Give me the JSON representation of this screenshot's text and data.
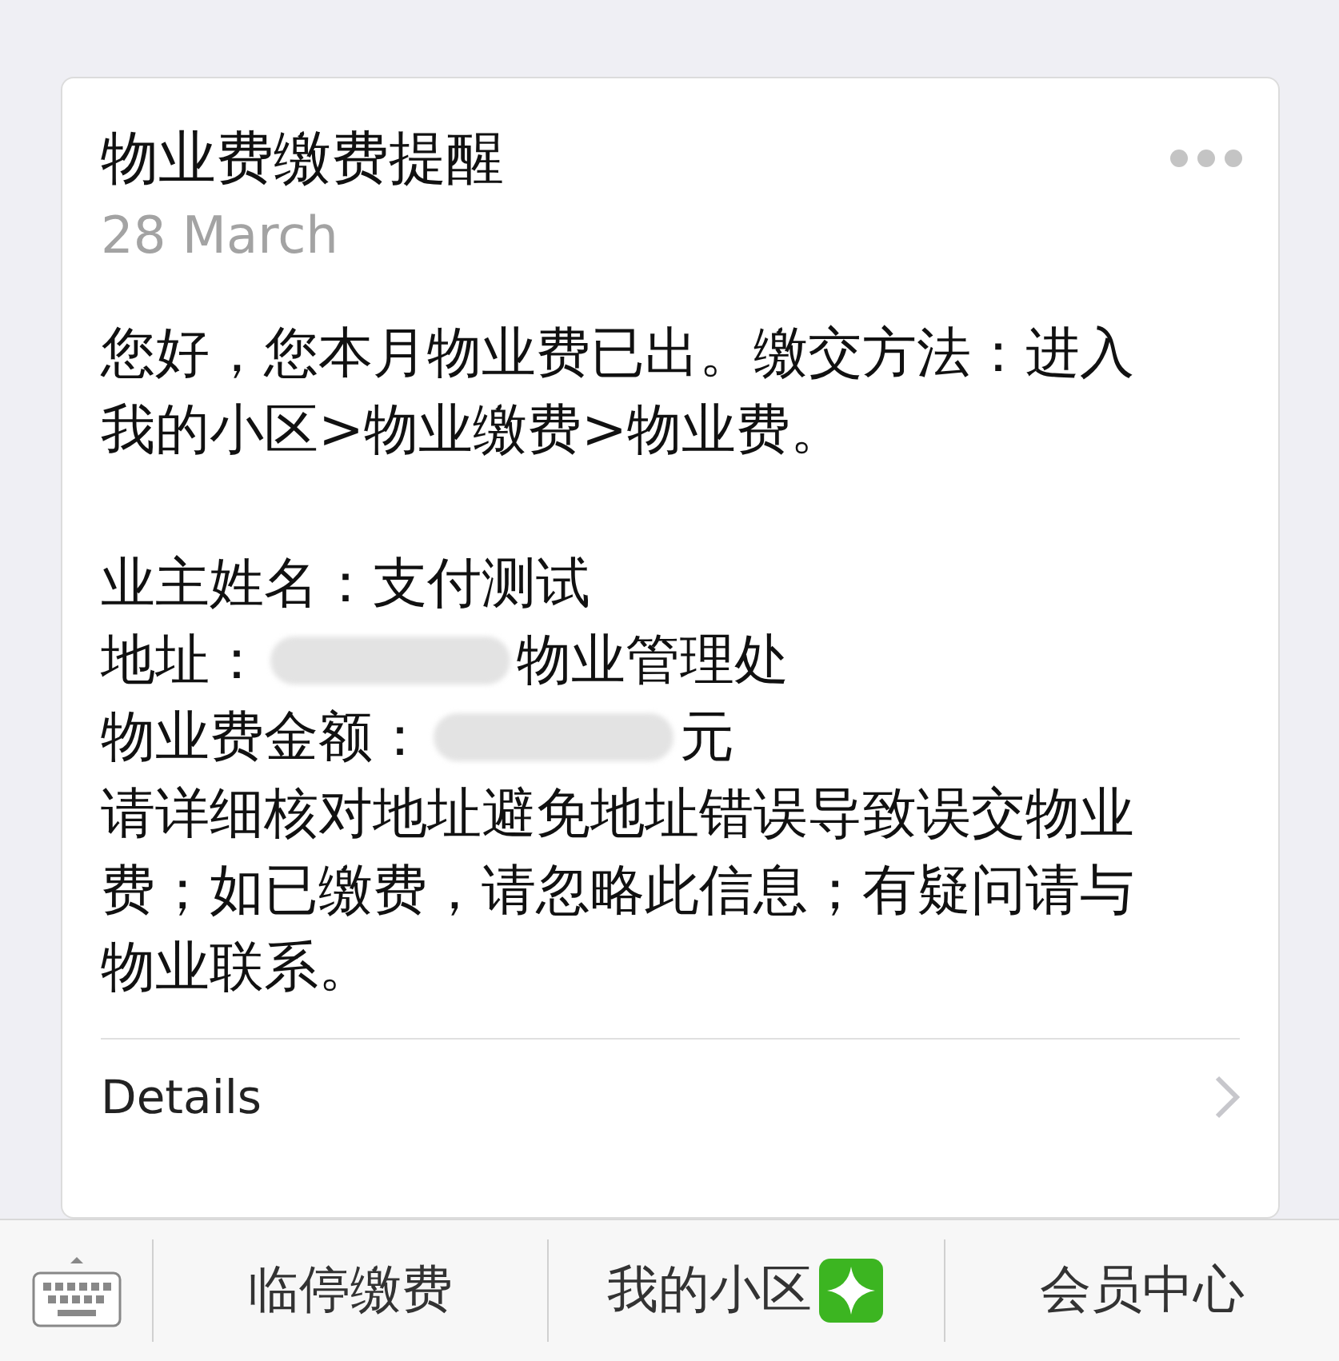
{
  "message": {
    "title": "物业费缴费提醒",
    "date": "28 March",
    "greeting": "您好，您本月物业费已出。缴交方法：进入我的小区>物业缴费>物业费。",
    "fields": [
      {
        "label": "业主姓名：",
        "value": "支付测试",
        "redacted": false
      },
      {
        "label": "地址：",
        "value": "物业管理处",
        "redacted": true
      },
      {
        "label": "物业费金额：",
        "value": "元",
        "redacted": true
      }
    ],
    "notice": "请详细核对地址避免地址错误导致误交物业费；如已缴费，请忽略此信息；有疑问请与物业联系。",
    "details": "Details"
  },
  "menu_bar": {
    "items": [
      {
        "label": "临停缴费",
        "kind": "plain"
      },
      {
        "label": "我的小区",
        "kind": "sparkle"
      },
      {
        "label": "会员中心",
        "kind": "plain"
      }
    ]
  }
}
